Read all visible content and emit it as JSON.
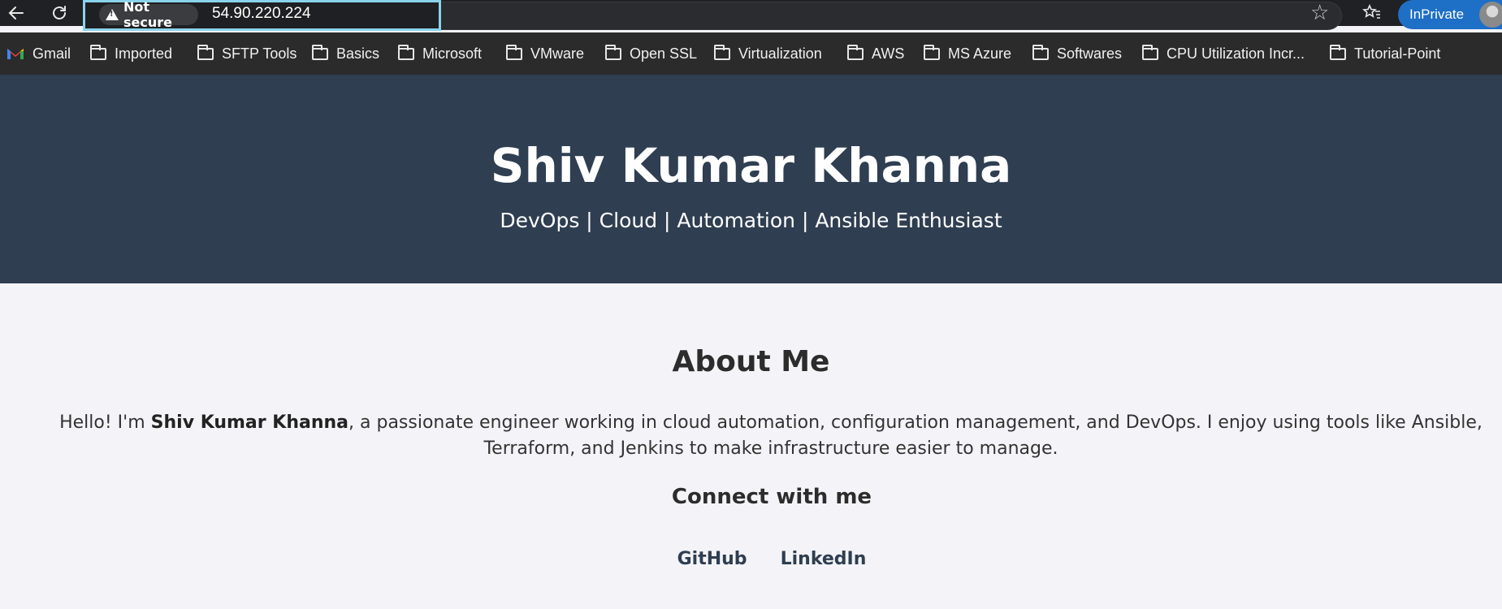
{
  "browser": {
    "security_label": "Not secure",
    "url": "54.90.220.224",
    "inprivate_label": "InPrivate"
  },
  "bookmarks": [
    {
      "label": "Gmail",
      "icon": "gmail-icon"
    },
    {
      "label": "Imported",
      "icon": "folder-icon"
    },
    {
      "label": "SFTP Tools",
      "icon": "folder-icon"
    },
    {
      "label": "Basics",
      "icon": "folder-icon"
    },
    {
      "label": "Microsoft",
      "icon": "folder-icon"
    },
    {
      "label": "VMware",
      "icon": "folder-icon"
    },
    {
      "label": "Open SSL",
      "icon": "folder-icon"
    },
    {
      "label": "Virtualization",
      "icon": "folder-icon"
    },
    {
      "label": "AWS",
      "icon": "folder-icon"
    },
    {
      "label": "MS Azure",
      "icon": "folder-icon"
    },
    {
      "label": "Softwares",
      "icon": "folder-icon"
    },
    {
      "label": "CPU Utilization Incr...",
      "icon": "folder-icon"
    },
    {
      "label": "Tutorial-Point",
      "icon": "folder-icon"
    }
  ],
  "hero": {
    "name": "Shiv Kumar Khanna",
    "tagline": "DevOps | Cloud | Automation | Ansible Enthusiast"
  },
  "about": {
    "heading": "About Me",
    "bio_prefix": "Hello! I'm ",
    "bio_name": "Shiv Kumar Khanna",
    "bio_suffix": ", a passionate engineer working in cloud automation, configuration management, and DevOps. I enjoy using tools like Ansible, Terraform, and Jenkins to make infrastructure easier to manage."
  },
  "connect": {
    "heading": "Connect with me",
    "links": [
      "GitHub",
      "LinkedIn"
    ]
  },
  "colors": {
    "hero_bg": "#2f3e51",
    "page_bg": "#f4f4f8",
    "inprivate_bg": "#1e6fc6",
    "address_highlight": "#8ad3ec"
  }
}
